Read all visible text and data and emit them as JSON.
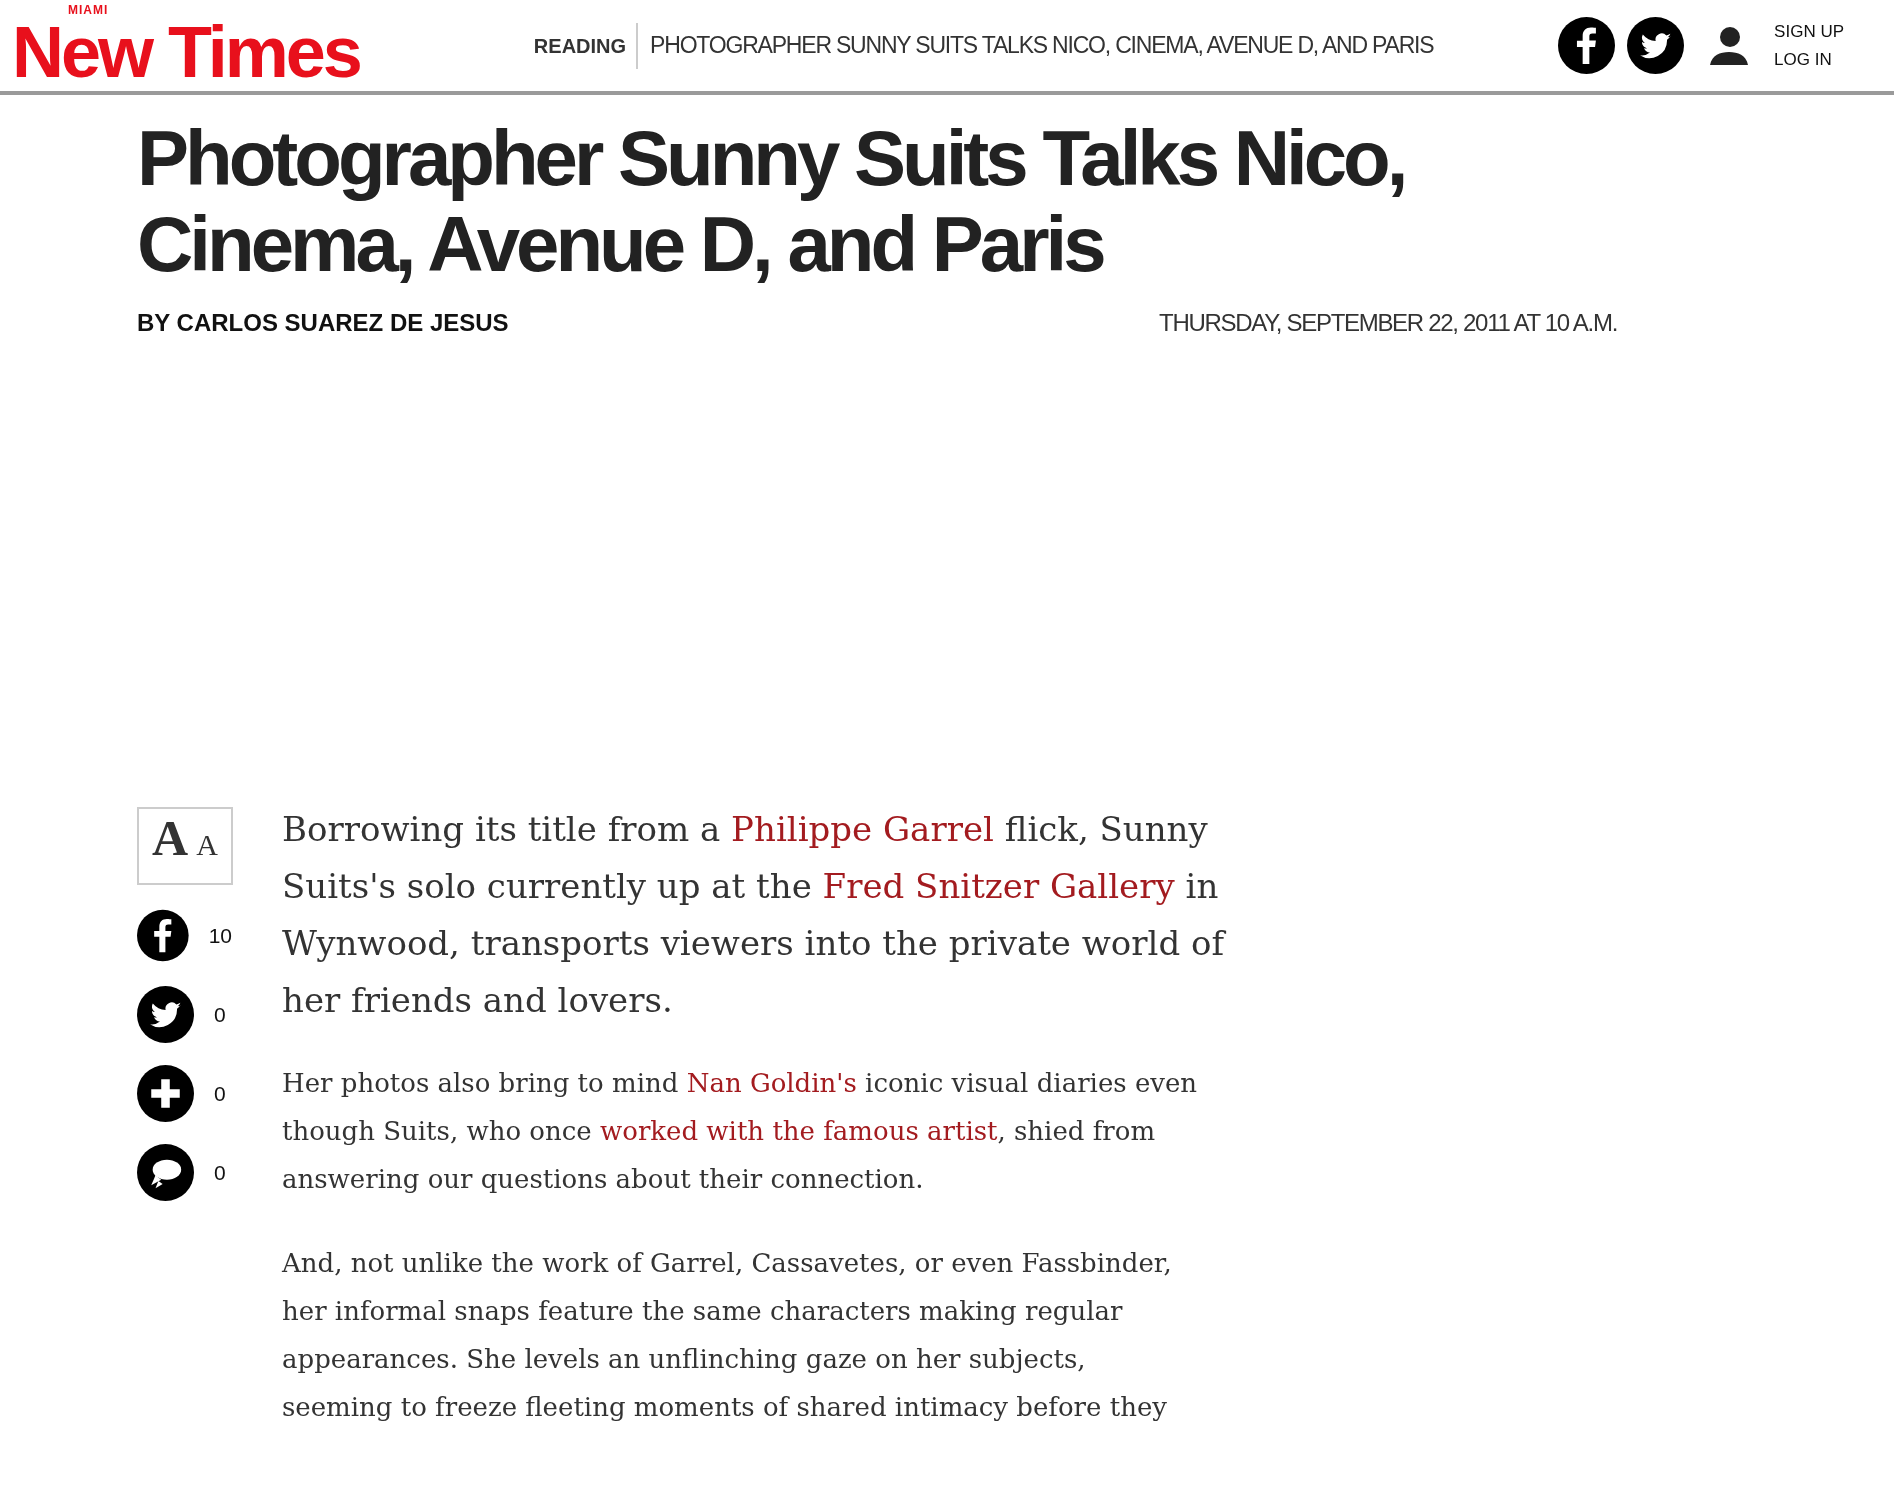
{
  "header": {
    "logo": {
      "small": "MIAMI",
      "main": "New Times"
    },
    "reading_label": "READING",
    "reading_title": "PHOTOGRAPHER SUNNY SUITS TALKS NICO, CINEMA, AVENUE D, AND PARIS",
    "social": [
      {
        "kind": "facebook"
      },
      {
        "kind": "twitter"
      }
    ],
    "account": [
      "SIGN UP",
      "LOG IN"
    ]
  },
  "article": {
    "title": "Photographer Sunny Suits Talks Nico, Cinema, Avenue D, and Paris",
    "byline": "BY CARLOS SUAREZ DE JESUS",
    "date": "THURSDAY, SEPTEMBER 22, 2011 AT 10 A.M.",
    "text_size": {
      "large": "A",
      "small": "A"
    },
    "shares": [
      {
        "kind": "facebook",
        "count": "10"
      },
      {
        "kind": "twitter",
        "count": "0"
      },
      {
        "kind": "plus",
        "count": "0"
      },
      {
        "kind": "comment",
        "count": "0"
      }
    ],
    "paragraphs": [
      {
        "kind": "lead",
        "segments": [
          {
            "kind": "text",
            "text": "Borrowing its title from a "
          },
          {
            "kind": "link",
            "text": "Philippe Garrel"
          },
          {
            "kind": "text",
            "text": " flick, Sunny Suits's solo currently up at the "
          },
          {
            "kind": "link",
            "text": "Fred Snitzer Gallery"
          },
          {
            "kind": "text",
            "text": " in Wynwood, transports viewers into the private world of her friends and lovers."
          }
        ]
      },
      {
        "kind": "body",
        "segments": [
          {
            "kind": "text",
            "text": "Her photos also bring to mind "
          },
          {
            "kind": "link",
            "text": "Nan Goldin's"
          },
          {
            "kind": "text",
            "text": " iconic visual diaries even though Suits, who once "
          },
          {
            "kind": "link",
            "text": "worked with the famous artist"
          },
          {
            "kind": "text",
            "text": ", shied from answering our questions about their connection."
          }
        ]
      },
      {
        "kind": "wrapped",
        "segments": [
          {
            "kind": "text",
            "text": "And, not unlike the work of Garrel, Cassavetes, or even Fassbinder, her informal snaps feature the same characters making regular appearances. She levels an unflinching gaze on her subjects, seeming to freeze fleeting moments of shared intimacy before they"
          }
        ]
      }
    ]
  }
}
